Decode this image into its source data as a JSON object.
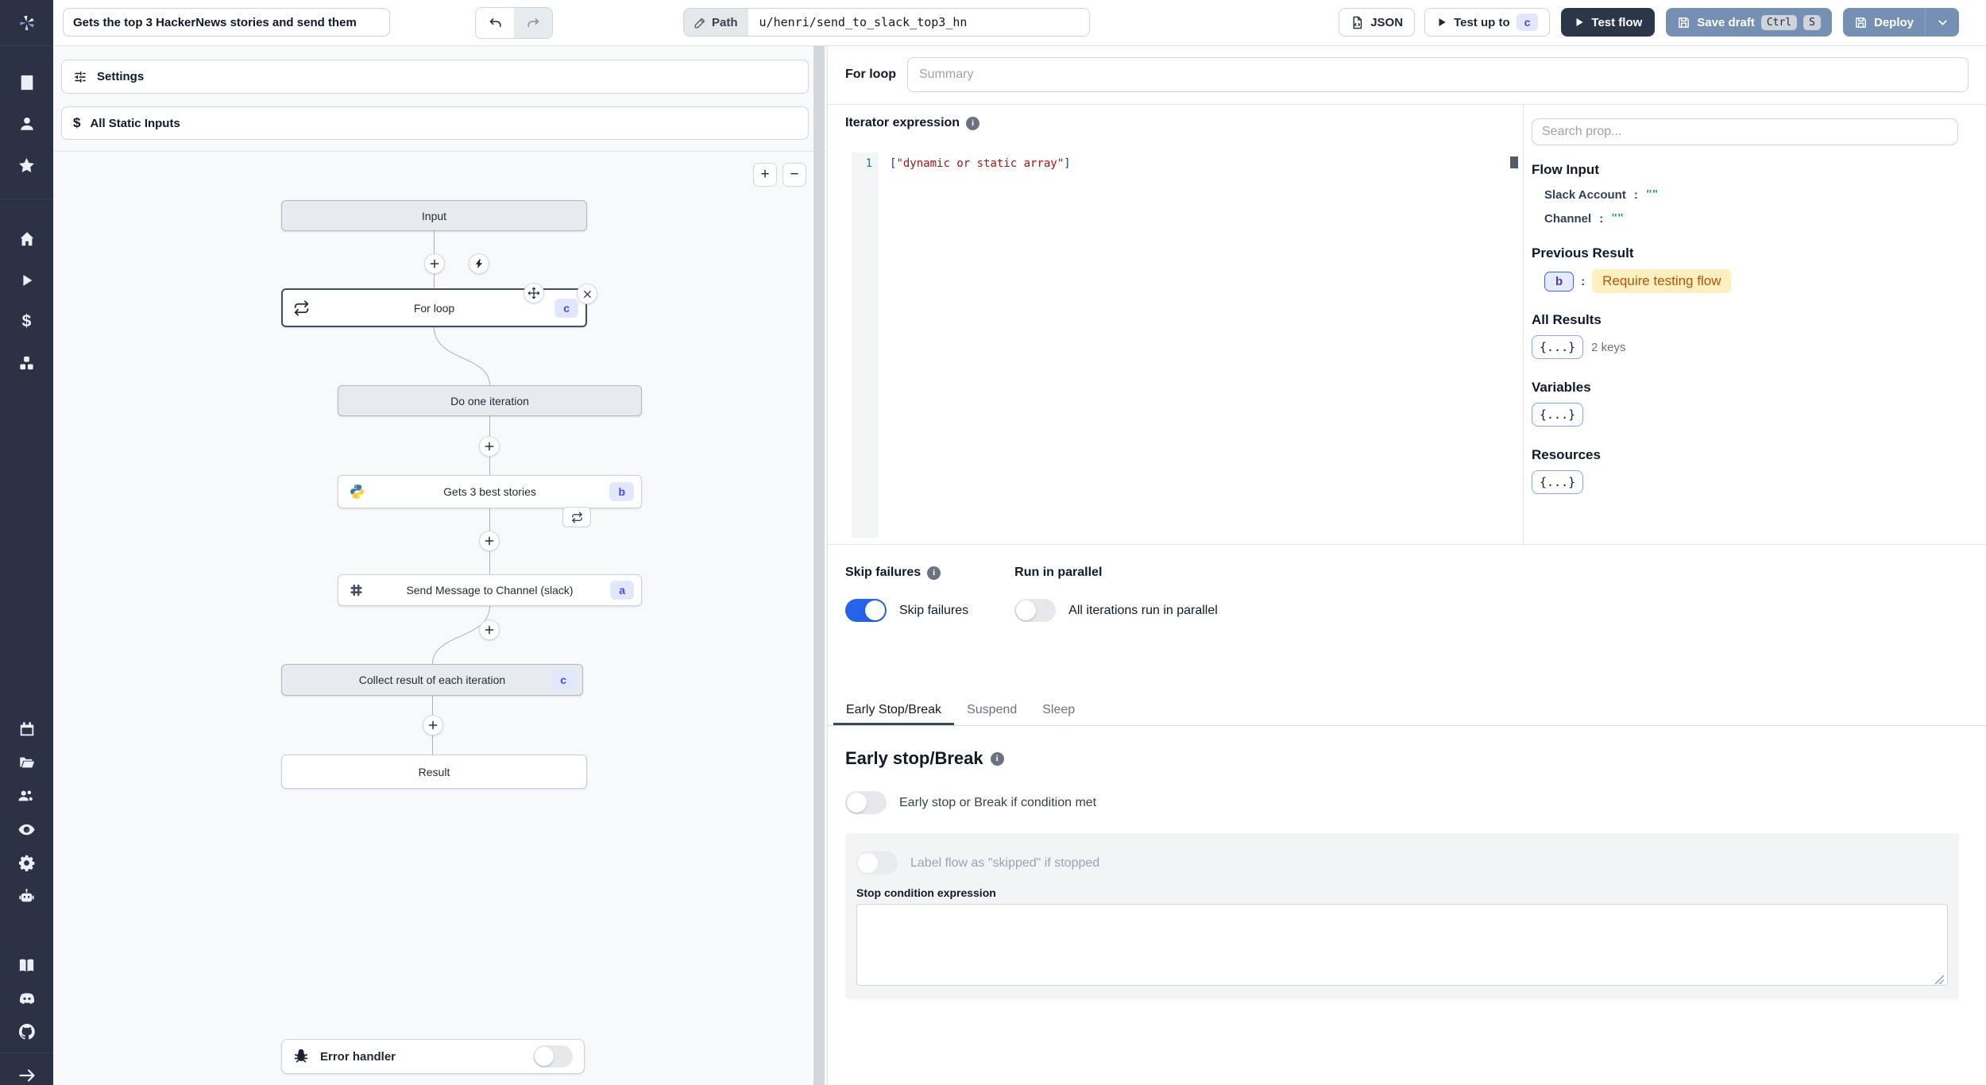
{
  "topbar": {
    "title_value": "Gets the top 3 HackerNews stories and send them",
    "path_label": "Path",
    "path_value": "u/henri/send_to_slack_top3_hn",
    "json_button": "JSON",
    "test_up_to": "Test up to",
    "test_up_to_badge": "c",
    "test_flow": "Test flow",
    "save_draft": "Save draft",
    "kbd_ctrl": "Ctrl",
    "kbd_s": "S",
    "deploy": "Deploy"
  },
  "canvas": {
    "settings": "Settings",
    "all_static_inputs": "All Static Inputs",
    "zoom_in": "+",
    "zoom_out": "−",
    "nodes": {
      "input": "Input",
      "for_loop": {
        "label": "For loop",
        "badge": "c"
      },
      "do_one_iteration": "Do one iteration",
      "gets_stories": {
        "label": "Gets 3 best stories",
        "badge": "b"
      },
      "send_message": {
        "label": "Send Message to Channel (slack)",
        "badge": "a"
      },
      "collect_result": {
        "label": "Collect result of each iteration",
        "badge": "c"
      },
      "result": "Result",
      "error_handler": "Error handler"
    }
  },
  "panel": {
    "step_title": "For loop",
    "summary_placeholder": "Summary",
    "iterator_label": "Iterator expression",
    "editor": {
      "line_number": "1",
      "bracket_open": "[",
      "string": "\"dynamic or static array\"",
      "bracket_close": "]"
    },
    "props": {
      "search_placeholder": "Search prop...",
      "flow_input_title": "Flow Input",
      "rows": [
        {
          "key": "Slack Account",
          "sep": ":",
          "value": "\"\""
        },
        {
          "key": "Channel",
          "sep": ":",
          "value": "\"\""
        }
      ],
      "previous_result_title": "Previous Result",
      "previous_result_badge": "b",
      "previous_result_sep": ":",
      "previous_result_value": "Require testing flow",
      "all_results_title": "All Results",
      "all_results_token": "{...}",
      "all_results_note": "2 keys",
      "variables_title": "Variables",
      "variables_token": "{...}",
      "resources_title": "Resources",
      "resources_token": "{...}"
    },
    "options": {
      "skip_failures_title": "Skip failures",
      "skip_failures_label": "Skip failures",
      "run_in_parallel_title": "Run in parallel",
      "run_in_parallel_label": "All iterations run in parallel"
    },
    "tabs": [
      {
        "label": "Early Stop/Break"
      },
      {
        "label": "Suspend"
      },
      {
        "label": "Sleep"
      }
    ],
    "early_stop": {
      "heading": "Early stop/Break",
      "toggle_label": "Early stop or Break if condition met",
      "skipped_label": "Label flow as \"skipped\" if stopped",
      "condition_label": "Stop condition expression"
    }
  },
  "colors": {
    "sidebar_bg": "#2b3245",
    "primary_button": "#7590b2",
    "dark_button": "#2b3648",
    "toggle_on": "#2563eb",
    "badge_bg": "#e0e7ff",
    "badge_text": "#4f46e5",
    "warning_bg": "#fdf0c0",
    "warning_text": "#b45309",
    "code_bracket": "#0431fa",
    "code_string": "#a31515",
    "value_green": "#16a34a"
  }
}
